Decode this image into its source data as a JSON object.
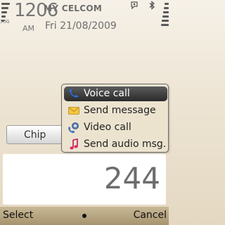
{
  "status": {
    "network_type": "3.5G",
    "time": "1206",
    "ampm": "AM",
    "operator": "MY CELCOM",
    "date": "Fri 21/08/2009",
    "icons": [
      "signal-strength-icon",
      "profile-icon",
      "bluetooth-icon",
      "battery-icon"
    ]
  },
  "chip": {
    "label": "Chip"
  },
  "dialer": {
    "number": "244"
  },
  "menu": {
    "items": [
      {
        "label": "Voice call",
        "icon": "phone-icon",
        "selected": true
      },
      {
        "label": "Send message",
        "icon": "envelope-icon",
        "selected": false
      },
      {
        "label": "Video call",
        "icon": "video-call-icon",
        "selected": false
      },
      {
        "label": "Send audio msg.",
        "icon": "music-note-icon",
        "selected": false
      }
    ]
  },
  "softkeys": {
    "left": "Select",
    "right": "Cancel"
  },
  "colors": {
    "background": "#ede4d3",
    "menu_background": "#ece3cf",
    "selection": "#3a3a3a",
    "softkey_bar": "#b6a47e"
  }
}
